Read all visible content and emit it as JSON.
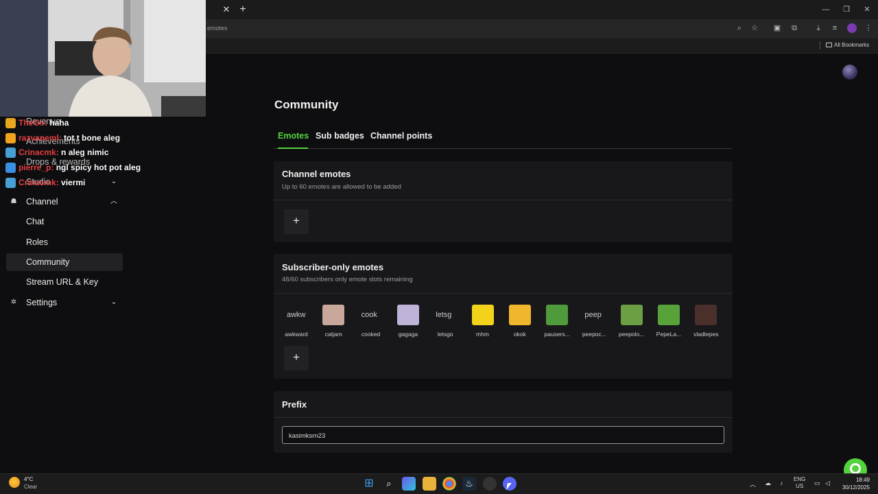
{
  "browser": {
    "url_visible": "emotes",
    "bookmarks_all": "All Bookmarks"
  },
  "page": {
    "title": "Community",
    "tabs": [
      {
        "label": "Emotes",
        "active": true
      },
      {
        "label": "Sub badges",
        "active": false
      },
      {
        "label": "Channel points",
        "active": false
      }
    ],
    "channel_emotes": {
      "title": "Channel emotes",
      "subtitle": "Up to 60 emotes are allowed to be added",
      "add_label": "+"
    },
    "subscriber_emotes": {
      "title": "Subscriber-only emotes",
      "subtitle": "48/60 subscribers only emote slots remaining",
      "add_label": "+",
      "emotes": [
        {
          "name": "awkward",
          "alt": "awkw",
          "color": ""
        },
        {
          "name": "catjam",
          "alt": "",
          "color": "#c9a79a"
        },
        {
          "name": "cooked",
          "alt": "cook",
          "color": ""
        },
        {
          "name": "gagaga",
          "alt": "",
          "color": "#bfb3d8"
        },
        {
          "name": "letsgo",
          "alt": "letsg",
          "color": ""
        },
        {
          "name": "mhm",
          "alt": "",
          "color": "#f3d21a"
        },
        {
          "name": "okok",
          "alt": "",
          "color": "#f1b72c"
        },
        {
          "name": "pausers...",
          "alt": "",
          "color": "#4f9a3b"
        },
        {
          "name": "peepoc...",
          "alt": "peep",
          "color": ""
        },
        {
          "name": "peepolo...",
          "alt": "",
          "color": "#6c9e43"
        },
        {
          "name": "PepeLa...",
          "alt": "",
          "color": "#57a33a"
        },
        {
          "name": "vladtepes",
          "alt": "",
          "color": "#4a2f2a"
        }
      ]
    },
    "prefix": {
      "title": "Prefix",
      "value": "kasimksrn23"
    }
  },
  "sidebar": {
    "ghost_items": [
      "Revenue",
      "Achievements",
      "Drops & rewards",
      "Studio"
    ],
    "items": [
      {
        "label": "Channel",
        "icon": "people-icon",
        "expanded": true
      },
      {
        "label": "Chat"
      },
      {
        "label": "Roles"
      },
      {
        "label": "Community",
        "selected": true
      },
      {
        "label": "Stream URL & Key"
      },
      {
        "label": "Settings",
        "icon": "gear-icon",
        "expanded": false
      }
    ]
  },
  "chat_overlay": [
    {
      "user": "TheGo:",
      "message": "haha",
      "badge_color": "#e8a51e"
    },
    {
      "user": "razvaneml:",
      "message": "tot t bone aleg",
      "badge_color": "#f0a41e"
    },
    {
      "user": "Crinacmk:",
      "message": "n aleg nimic",
      "badge_color": "#46a0d6"
    },
    {
      "user": "pierre_p:",
      "message": "ngl spicy hot pot aleg",
      "badge_color": "#3a8fe0"
    },
    {
      "user": "Crinacmk:",
      "message": "viermi",
      "badge_color": "#46a0d6"
    }
  ],
  "taskbar": {
    "weather_temp": "4°C",
    "weather_cond": "Clear",
    "lang_top": "ENG",
    "lang_bottom": "US",
    "time": "18:49",
    "date": "30/12/2025"
  },
  "colors": {
    "accent": "#53d33d",
    "page_bg": "#0e0e10",
    "card_bg": "#18181b"
  }
}
